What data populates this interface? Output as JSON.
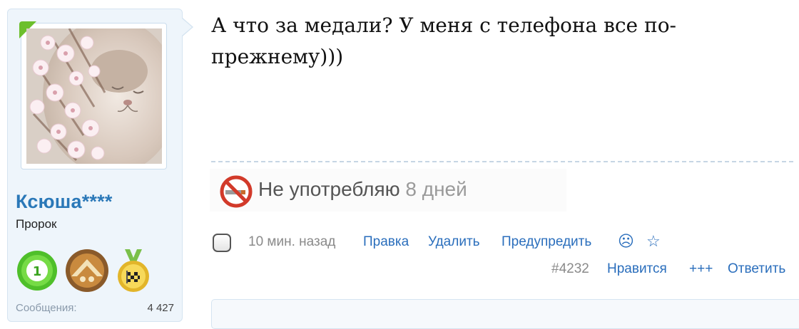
{
  "author": {
    "username": "Ксюша****",
    "rank": "Пророк",
    "stats_label": "Сообщения:",
    "stats_value": "4 427",
    "badge_number": "1",
    "accent_green": "#6cbf2c",
    "name_color": "#2a78b8"
  },
  "post": {
    "text": "А что за медали? У меня с телефона все по-прежнему)))"
  },
  "signature": {
    "icon": "no-smoking-icon",
    "text": "Не употребляю",
    "days": "8 дней"
  },
  "actions": {
    "timestamp": "10 мин. назад",
    "edit": "Правка",
    "delete": "Удалить",
    "warn": "Предупредить",
    "sad_icon": "☹",
    "star_icon": "☆",
    "post_number": "#4232",
    "like": "Нравится",
    "plus": "+++",
    "reply": "Ответить"
  }
}
